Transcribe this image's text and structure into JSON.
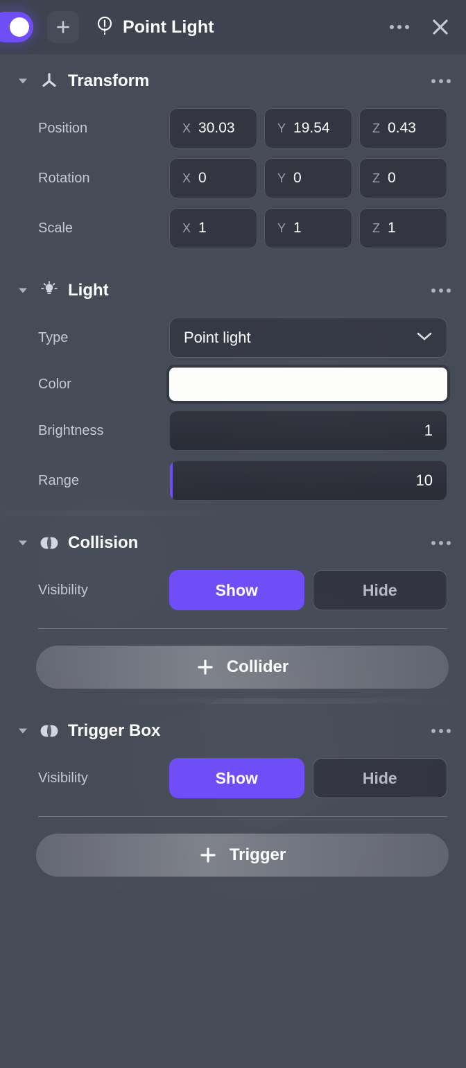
{
  "header": {
    "enabled_toggle": "on",
    "add_label": "+",
    "object_icon": "point-light-icon",
    "title": "Point Light",
    "more_label": "...",
    "close_label": "✕"
  },
  "sections": [
    {
      "name": "transform",
      "icon": "transform-gizmo-icon",
      "title": "Transform",
      "expanded": true,
      "rows": [
        {
          "label": "Position",
          "fields": [
            {
              "axis": "X",
              "value": "30.03"
            },
            {
              "axis": "Y",
              "value": "19.54"
            },
            {
              "axis": "Z",
              "value": "0.43"
            }
          ]
        },
        {
          "label": "Rotation",
          "fields": [
            {
              "axis": "X",
              "value": "0"
            },
            {
              "axis": "Y",
              "value": "0"
            },
            {
              "axis": "Z",
              "value": "0"
            }
          ]
        },
        {
          "label": "Scale",
          "fields": [
            {
              "axis": "X",
              "value": "1"
            },
            {
              "axis": "Y",
              "value": "1"
            },
            {
              "axis": "Z",
              "value": "1"
            }
          ]
        }
      ]
    },
    {
      "name": "light",
      "icon": "lightbulb-icon",
      "title": "Light",
      "expanded": true,
      "type_row": {
        "label": "Type",
        "value": "Point light",
        "chevron": "chevron-down-icon"
      },
      "color_row": {
        "label": "Color",
        "value": "#FDFDFB"
      },
      "brightness_row": {
        "label": "Brightness",
        "value": "1",
        "fill_percent": 0
      },
      "range_row": {
        "label": "Range",
        "value": "10",
        "fill_percent": 1
      }
    },
    {
      "name": "collision",
      "icon": "collision-venn-icon",
      "title": "Collision",
      "expanded": true,
      "visibility": {
        "label": "Visibility",
        "show_label": "Show",
        "hide_label": "Hide",
        "selected": "Show"
      },
      "add_button": {
        "plus": "+",
        "label": "Collider"
      }
    },
    {
      "name": "trigger-box",
      "icon": "collision-venn-icon",
      "title": "Trigger Box",
      "expanded": true,
      "visibility": {
        "label": "Visibility",
        "show_label": "Show",
        "hide_label": "Hide",
        "selected": "Show"
      },
      "add_button": {
        "plus": "+",
        "label": "Trigger"
      }
    }
  ],
  "colors": {
    "accent": "#6F4EF7",
    "panel": "#474B58",
    "titlebar": "#3F4350",
    "field": "#1E1F27",
    "text": "#FFFFFF",
    "muted": "#C6C9D2"
  }
}
